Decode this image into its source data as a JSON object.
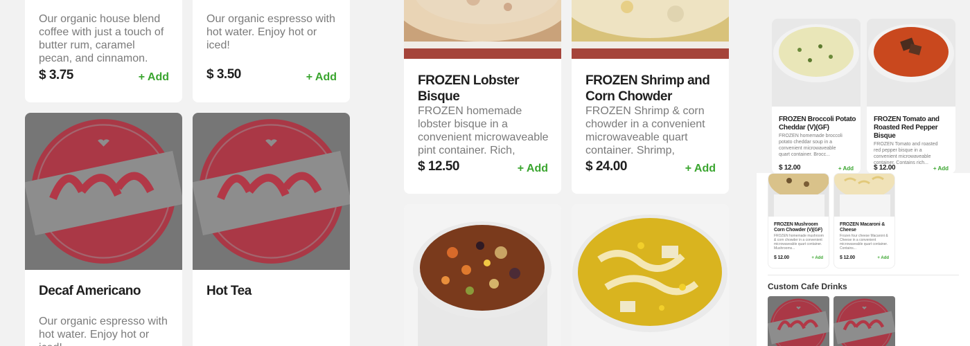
{
  "left": {
    "top_cards": [
      {
        "desc": "Our organic house blend coffee with just a touch of butter rum, caramel pecan, and cinnamon. Enjo...",
        "price": "$ 3.75",
        "add": "+ Add"
      },
      {
        "desc": "Our organic espresso with hot water. Enjoy hot or iced!",
        "price": "$ 3.50",
        "add": "+ Add"
      }
    ],
    "bottom_cards": [
      {
        "title": "Decaf Americano",
        "desc": "Our organic espresso with hot water. Enjoy hot or iced!",
        "image": "andy-peppers-logo"
      },
      {
        "title": "Hot Tea",
        "desc": "",
        "image": "andy-peppers-logo"
      }
    ]
  },
  "middle": {
    "top_cards": [
      {
        "title": "FROZEN Lobster Bisque",
        "desc": "FROZEN homemade lobster bisque in a convenient microwaveable pint container. Rich, creamy, and d...",
        "price": "$ 12.50",
        "add": "+ Add"
      },
      {
        "title": "FROZEN Shrimp and Corn Chowder",
        "desc": "FROZEN Shrimp & corn chowder in a convenient microwaveable quart container. Shrimp, potatoes, swe...",
        "price": "$ 24.00",
        "add": "+ Add"
      }
    ],
    "bottom_cards": [
      {
        "image": "vegetable-soup-photo"
      },
      {
        "image": "chicken-noodle-soup-photo"
      }
    ]
  },
  "right": {
    "top_cards": [
      {
        "title": "FROZEN Broccoli Potato Cheddar (V)(GF)",
        "desc": "FROZEN homemade broccoli potato cheddar soup in a convenient microwaveable quart container. Brocc...",
        "price": "$ 12.00",
        "add": "+ Add"
      },
      {
        "title": "FROZEN Tomato and Roasted Red Pepper Bisque",
        "desc": "FROZEN Tomato and roasted red pepper bisque in a convenient microwaveable container. Contains rich...",
        "price": "$ 12.00",
        "add": "+ Add"
      }
    ],
    "mid_cards": [
      {
        "title": "FROZEN Mushroom Corn Chowder (V)(GF)",
        "desc": "FROZEN homemade mushroom & corn chowder in a convenient microwaveable quart container. Mushrooms...",
        "price": "$ 12.00",
        "add": "+ Add"
      },
      {
        "title": "FROZEN Macaroni & Cheese",
        "desc": "Frozen four cheese Macaroni & Cheese in a convenient microwaveable quart container. Contains...",
        "price": "$ 12.00",
        "add": "+ Add"
      }
    ],
    "section_heading": "Custom Cafe Drinks"
  },
  "colors": {
    "add_green": "#3aa52f",
    "logo_red": "#b8293b",
    "logo_overlay_gray": "#767676"
  }
}
